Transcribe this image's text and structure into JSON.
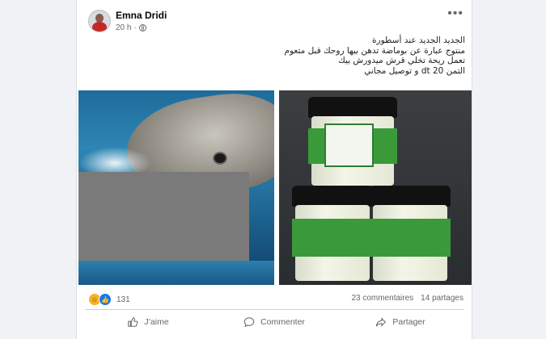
{
  "post": {
    "author": "Emna Dridi",
    "time": "20 h",
    "separator": "·",
    "text_lines": [
      "الجديد الجديد عند أسطورة",
      "منتوج عبارة عن بوماضة تدهن بيها روحك قبل متعوم",
      "تعمل ريحة تخلي قرش ميدورش بيك",
      "التمن dt 20 و توصيل مجاني"
    ]
  },
  "stats": {
    "reaction_count": "131",
    "comments": "23 commentaires",
    "shares": "14 partages"
  },
  "actions": {
    "like": "J’aime",
    "comment": "Commenter",
    "share": "Partager"
  },
  "icons": {
    "more": "more-options-icon",
    "privacy": "globe-icon",
    "reactions": [
      "haha-icon",
      "like-icon"
    ]
  },
  "colors": {
    "background": "#f0f2f5",
    "card": "#ffffff",
    "secondary_text": "#65676b",
    "like_blue": "#1877f2"
  }
}
